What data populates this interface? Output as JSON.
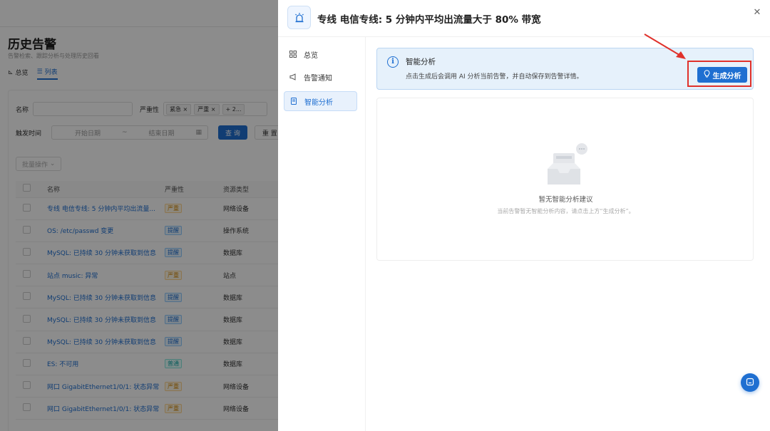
{
  "background": {
    "page_title": "历史告警",
    "page_subtitle": "告警检索、跟踪分析与处理历史回看",
    "view_tabs": [
      {
        "label": "总览",
        "icon": "chart-icon"
      },
      {
        "label": "列表",
        "icon": "list-icon",
        "active": true
      }
    ],
    "filters": {
      "name_label": "名称",
      "severity_label": "严重性",
      "severity_tags": [
        "紧急",
        "严重",
        "+ 2..."
      ],
      "time_label": "触发时间",
      "start_placeholder": "开始日期",
      "range_sep": "~",
      "end_placeholder": "结束日期",
      "query_label": "查 询",
      "reset_label": "重 置"
    },
    "batch_label": "批量操作",
    "table": {
      "columns": [
        "名称",
        "严重性",
        "资源类型"
      ],
      "rows": [
        {
          "name": "专线 电信专线: 5 分钟内平均出流量...",
          "severity": "严重",
          "sev_style": "orange",
          "type": "网络设备"
        },
        {
          "name": "OS: /etc/passwd 变更",
          "severity": "提醒",
          "sev_style": "blue",
          "type": "操作系统"
        },
        {
          "name": "MySQL: 已持续 30 分钟未获取到信息",
          "severity": "提醒",
          "sev_style": "blue",
          "type": "数据库"
        },
        {
          "name": "站点 music: 异常",
          "severity": "严重",
          "sev_style": "orange",
          "type": "站点"
        },
        {
          "name": "MySQL: 已持续 30 分钟未获取到信息",
          "severity": "提醒",
          "sev_style": "blue",
          "type": "数据库"
        },
        {
          "name": "MySQL: 已持续 30 分钟未获取到信息",
          "severity": "提醒",
          "sev_style": "blue",
          "type": "数据库"
        },
        {
          "name": "MySQL: 已持续 30 分钟未获取到信息",
          "severity": "提醒",
          "sev_style": "blue",
          "type": "数据库"
        },
        {
          "name": "ES: 不可用",
          "severity": "普通",
          "sev_style": "teal",
          "type": "数据库"
        },
        {
          "name": "网口 GigabitEthernet1/0/1: 状态异常",
          "severity": "严重",
          "sev_style": "orange",
          "type": "网络设备"
        },
        {
          "name": "网口 GigabitEthernet1/0/1: 状态异常",
          "severity": "严重",
          "sev_style": "orange",
          "type": "网络设备"
        }
      ]
    }
  },
  "drawer": {
    "title": "专线 电信专线: 5 分钟内平均出流量大于 80% 带宽",
    "close_icon": "close-icon",
    "nav": [
      {
        "label": "总览",
        "icon": "grid-icon"
      },
      {
        "label": "告警通知",
        "icon": "megaphone-icon"
      },
      {
        "label": "智能分析",
        "icon": "document-icon",
        "active": true
      }
    ],
    "info": {
      "title": "智能分析",
      "text": "点击生成后会调用 AI 分析当前告警，并自动保存到告警详情。",
      "button_label": "生成分析"
    },
    "empty": {
      "title": "暂无智能分析建议",
      "desc": "当前告警暂无智能分析内容，请点击上方“生成分析”。"
    }
  },
  "colors": {
    "primary": "#1f6fd1",
    "highlight_red": "#e0312b",
    "info_bg": "#e6f1fb"
  }
}
